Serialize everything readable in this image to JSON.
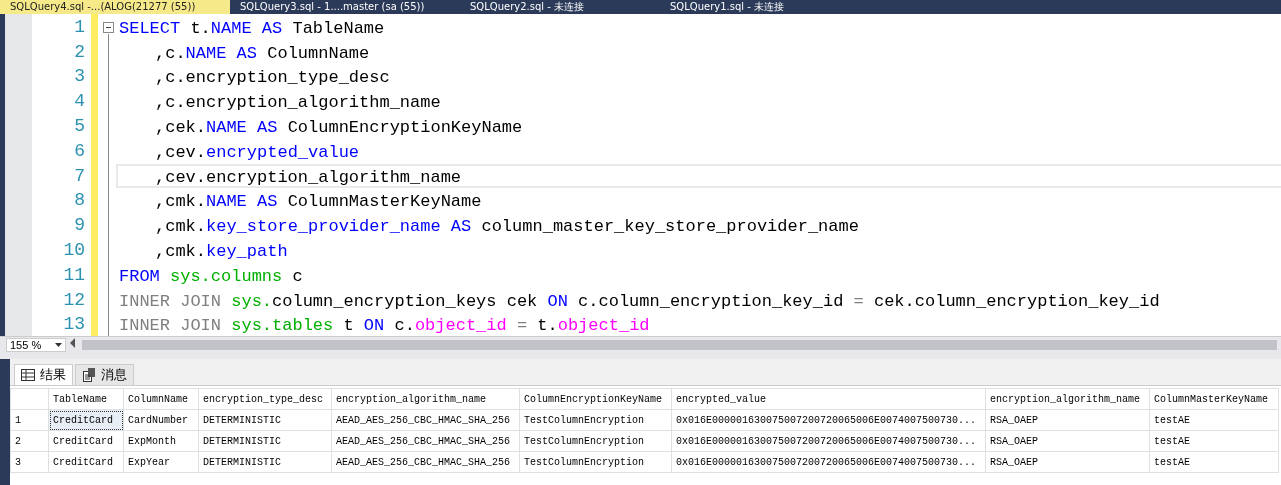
{
  "tabs": [
    {
      "label": "SQLQuery4.sql -...(ALOG(21277 (55))",
      "selected": true
    },
    {
      "label": "SQLQuery3.sql - 1....master (sa (55))",
      "selected": false
    },
    {
      "label": "SQLQuery2.sql - 未连接",
      "selected": false
    },
    {
      "label": "SQLQuery1.sql - 未连接",
      "selected": false
    }
  ],
  "editor": {
    "lines": [
      {
        "number": "1",
        "current": false,
        "indent": false,
        "tokens": [
          {
            "kind": "kw",
            "text": "SELECT"
          },
          {
            "kind": "plain",
            "text": " t."
          },
          {
            "kind": "kw",
            "text": "NAME AS"
          },
          {
            "kind": "plain",
            "text": " TableName"
          }
        ]
      },
      {
        "number": "2",
        "current": false,
        "indent": true,
        "tokens": [
          {
            "kind": "plain",
            "text": ",c."
          },
          {
            "kind": "kw",
            "text": "NAME AS"
          },
          {
            "kind": "plain",
            "text": " ColumnName"
          }
        ]
      },
      {
        "number": "3",
        "current": false,
        "indent": true,
        "tokens": [
          {
            "kind": "plain",
            "text": ",c.encryption_type_desc"
          }
        ]
      },
      {
        "number": "4",
        "current": false,
        "indent": true,
        "tokens": [
          {
            "kind": "plain",
            "text": ",c.encryption_algorithm_name"
          }
        ]
      },
      {
        "number": "5",
        "current": false,
        "indent": true,
        "tokens": [
          {
            "kind": "plain",
            "text": ",cek."
          },
          {
            "kind": "kw",
            "text": "NAME AS"
          },
          {
            "kind": "plain",
            "text": " ColumnEncryptionKeyName"
          }
        ]
      },
      {
        "number": "6",
        "current": false,
        "indent": true,
        "tokens": [
          {
            "kind": "plain",
            "text": ",cev."
          },
          {
            "kind": "kw",
            "text": "encrypted_value"
          }
        ]
      },
      {
        "number": "7",
        "current": true,
        "indent": true,
        "tokens": [
          {
            "kind": "plain",
            "text": ",cev.encryption_algorithm_name"
          }
        ]
      },
      {
        "number": "8",
        "current": false,
        "indent": true,
        "tokens": [
          {
            "kind": "plain",
            "text": ",cmk."
          },
          {
            "kind": "kw",
            "text": "NAME AS"
          },
          {
            "kind": "plain",
            "text": " ColumnMasterKeyName"
          }
        ]
      },
      {
        "number": "9",
        "current": false,
        "indent": true,
        "tokens": [
          {
            "kind": "plain",
            "text": ",cmk."
          },
          {
            "kind": "kw",
            "text": "key_store_provider_name AS"
          },
          {
            "kind": "plain",
            "text": " column_master_key_store_provider_name"
          }
        ]
      },
      {
        "number": "10",
        "current": false,
        "indent": true,
        "tokens": [
          {
            "kind": "plain",
            "text": ",cmk."
          },
          {
            "kind": "kw",
            "text": "key_path"
          }
        ]
      },
      {
        "number": "11",
        "current": false,
        "indent": false,
        "tokens": [
          {
            "kind": "kw",
            "text": "FROM"
          },
          {
            "kind": "sys",
            "text": " sys.columns"
          },
          {
            "kind": "plain",
            "text": " c"
          }
        ]
      },
      {
        "number": "12",
        "current": false,
        "indent": false,
        "tokens": [
          {
            "kind": "op",
            "text": "INNER JOIN"
          },
          {
            "kind": "sys",
            "text": " sys."
          },
          {
            "kind": "plain",
            "text": "column_encryption_keys cek "
          },
          {
            "kind": "kw",
            "text": "ON"
          },
          {
            "kind": "plain",
            "text": " c.column_encryption_key_id "
          },
          {
            "kind": "op",
            "text": "="
          },
          {
            "kind": "plain",
            "text": " cek.column_encryption_key_id"
          }
        ]
      },
      {
        "number": "13",
        "current": false,
        "indent": false,
        "tokens": [
          {
            "kind": "op",
            "text": "INNER JOIN"
          },
          {
            "kind": "sys",
            "text": " sys.tables"
          },
          {
            "kind": "plain",
            "text": " t "
          },
          {
            "kind": "kw",
            "text": "ON"
          },
          {
            "kind": "plain",
            "text": " c."
          },
          {
            "kind": "fn",
            "text": "object_id"
          },
          {
            "kind": "op",
            "text": " ="
          },
          {
            "kind": "plain",
            "text": " t."
          },
          {
            "kind": "fn",
            "text": "object_id"
          }
        ]
      }
    ]
  },
  "zoom": {
    "value": "155 %"
  },
  "result_tabs": [
    {
      "label": "结果",
      "kind": "grid",
      "selected": true
    },
    {
      "label": "消息",
      "kind": "messages",
      "selected": false
    }
  ],
  "table": {
    "columns": [
      "TableName",
      "ColumnName",
      "encryption_type_desc",
      "encryption_algorithm_name",
      "ColumnEncryptionKeyName",
      "encrypted_value",
      "encryption_algorithm_name",
      "ColumnMasterKeyName"
    ],
    "rows": [
      {
        "number": "1",
        "cells": [
          {
            "text": "CreditCard",
            "focused": true
          },
          {
            "text": "CardNumber",
            "focused": false
          },
          {
            "text": "DETERMINISTIC",
            "focused": false
          },
          {
            "text": "AEAD_AES_256_CBC_HMAC_SHA_256",
            "focused": false
          },
          {
            "text": "TestColumnEncryption",
            "focused": false
          },
          {
            "text": "0x016E000001630075007200720065006E0074007500730...",
            "focused": false
          },
          {
            "text": "RSA_OAEP",
            "focused": false
          },
          {
            "text": "testAE",
            "focused": false
          }
        ]
      },
      {
        "number": "2",
        "cells": [
          {
            "text": "CreditCard",
            "focused": false
          },
          {
            "text": "ExpMonth",
            "focused": false
          },
          {
            "text": "DETERMINISTIC",
            "focused": false
          },
          {
            "text": "AEAD_AES_256_CBC_HMAC_SHA_256",
            "focused": false
          },
          {
            "text": "TestColumnEncryption",
            "focused": false
          },
          {
            "text": "0x016E000001630075007200720065006E0074007500730...",
            "focused": false
          },
          {
            "text": "RSA_OAEP",
            "focused": false
          },
          {
            "text": "testAE",
            "focused": false
          }
        ]
      },
      {
        "number": "3",
        "cells": [
          {
            "text": "CreditCard",
            "focused": false
          },
          {
            "text": "ExpYear",
            "focused": false
          },
          {
            "text": "DETERMINISTIC",
            "focused": false
          },
          {
            "text": "AEAD_AES_256_CBC_HMAC_SHA_256",
            "focused": false
          },
          {
            "text": "TestColumnEncryption",
            "focused": false
          },
          {
            "text": "0x016E000001630075007200720065006E0074007500730...",
            "focused": false
          },
          {
            "text": "RSA_OAEP",
            "focused": false
          },
          {
            "text": "testAE",
            "focused": false
          }
        ]
      }
    ]
  }
}
